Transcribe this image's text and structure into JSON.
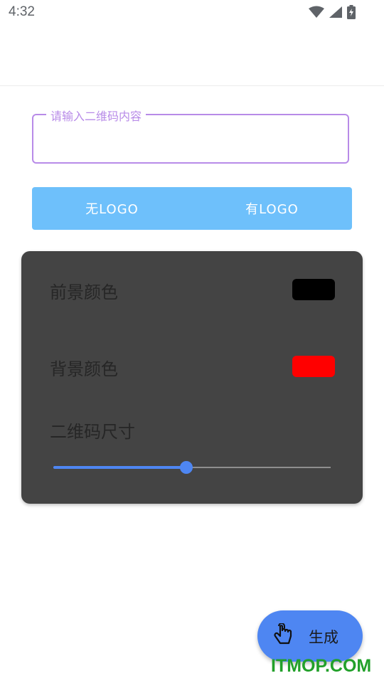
{
  "status_bar": {
    "time": "4:32",
    "icons": [
      "wifi-icon",
      "cellular-signal-icon",
      "battery-charging-icon"
    ]
  },
  "input": {
    "label": "请输入二维码内容",
    "value": ""
  },
  "logo_toggle": {
    "no_logo": "无LOGO",
    "with_logo": "有LOGO",
    "color": "#6ec0fb"
  },
  "settings": {
    "foreground": {
      "label": "前景颜色",
      "color": "#000000"
    },
    "background": {
      "label": "背景颜色",
      "color": "#ff0000"
    },
    "size": {
      "label": "二维码尺寸",
      "value": 0.48
    }
  },
  "fab": {
    "label": "生成",
    "icon": "touch-icon",
    "color": "#4e86f2"
  },
  "watermark": "ITMOP.COM"
}
